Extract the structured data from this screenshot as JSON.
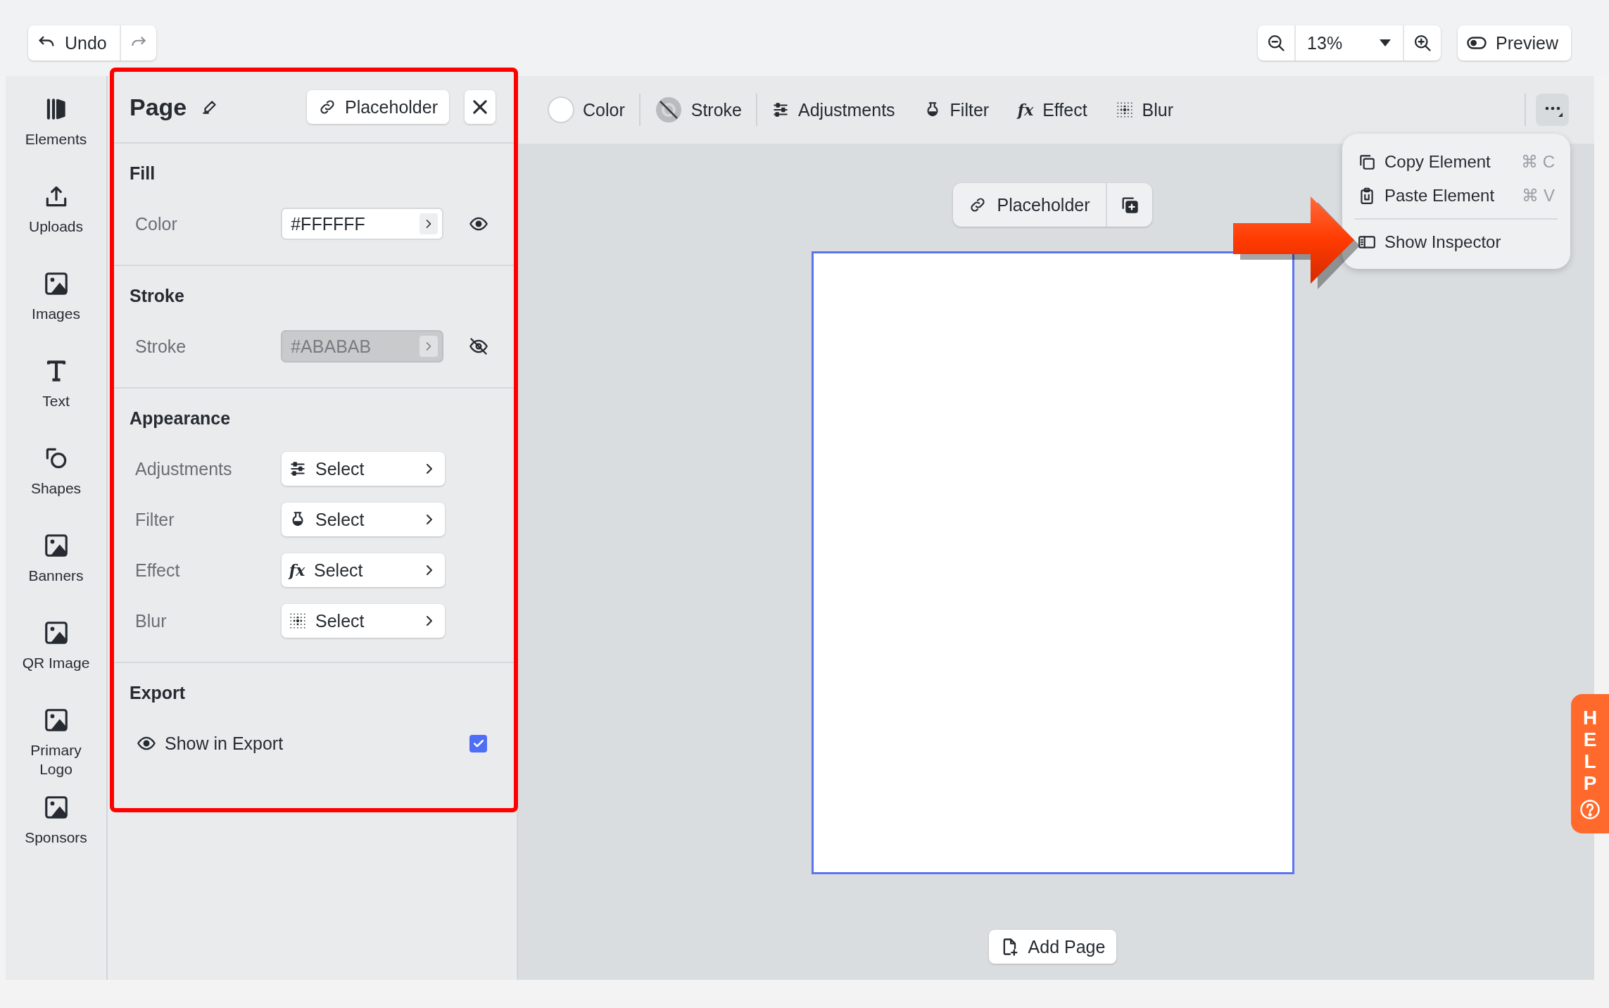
{
  "top_bar": {
    "undo": {
      "label": "Undo"
    },
    "zoom": {
      "value": "13%"
    },
    "preview": {
      "label": "Preview"
    }
  },
  "sidebar": {
    "items": [
      {
        "kind": "elements",
        "label": "Elements"
      },
      {
        "kind": "upload",
        "label": "Uploads"
      },
      {
        "kind": "image",
        "label": "Images"
      },
      {
        "kind": "text",
        "label": "Text"
      },
      {
        "kind": "shapes",
        "label": "Shapes"
      },
      {
        "kind": "image",
        "label": "Banners"
      },
      {
        "kind": "image",
        "label": "QR Image"
      },
      {
        "kind": "image",
        "label": "Primary Logo"
      },
      {
        "kind": "image",
        "label": "Sponsors"
      }
    ]
  },
  "inspector": {
    "title": "Page",
    "placeholder_button": "Placeholder",
    "sections": [
      {
        "title": "Fill",
        "rows": [
          {
            "kind": "color",
            "label": "Color",
            "value": "#FFFFFF",
            "disabled": false,
            "visible": true
          }
        ]
      },
      {
        "title": "Stroke",
        "rows": [
          {
            "kind": "color",
            "label": "Stroke",
            "value": "#ABABAB",
            "disabled": true,
            "visible": false
          }
        ]
      },
      {
        "title": "Appearance",
        "rows": [
          {
            "kind": "adjustments",
            "label": "Adjustments",
            "value": "Select"
          },
          {
            "kind": "filter",
            "label": "Filter",
            "value": "Select"
          },
          {
            "kind": "effect",
            "icon_text": "fx",
            "label": "Effect",
            "value": "Select"
          },
          {
            "kind": "blur",
            "label": "Blur",
            "value": "Select"
          }
        ]
      },
      {
        "title": "Export",
        "rows": [
          {
            "kind": "checkbox",
            "label": "Show in Export",
            "checked": true
          }
        ]
      }
    ]
  },
  "toolbar": {
    "items": [
      {
        "kind": "color",
        "label": "Color"
      },
      {
        "kind": "stroke",
        "label": "Stroke"
      },
      {
        "kind": "adjustments",
        "label": "Adjustments"
      },
      {
        "kind": "filter",
        "label": "Filter"
      },
      {
        "kind": "effect",
        "icon_text": "fx",
        "label": "Effect"
      },
      {
        "kind": "blur",
        "label": "Blur"
      }
    ]
  },
  "canvas": {
    "placeholder_button": "Placeholder",
    "add_page": "Add Page"
  },
  "context_menu": {
    "groups": [
      [
        {
          "kind": "copy",
          "label": "Copy Element",
          "shortcut": "⌘ C"
        },
        {
          "kind": "paste",
          "label": "Paste Element",
          "shortcut": "⌘ V"
        }
      ],
      [
        {
          "kind": "inspector",
          "label": "Show Inspector"
        }
      ]
    ]
  },
  "help_tab": {
    "label": "HELP"
  }
}
